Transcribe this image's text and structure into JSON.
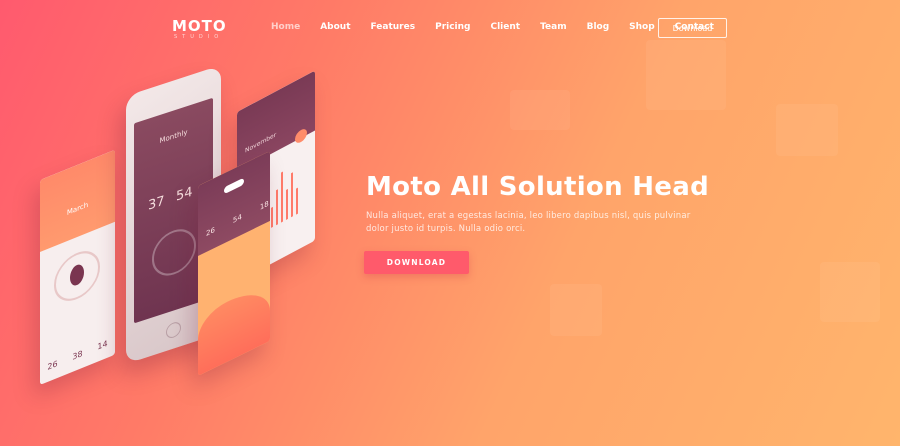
{
  "brand": {
    "logo": "MOTO",
    "tagline": "STUDIO"
  },
  "nav": {
    "items": [
      {
        "label": "Home",
        "active": true
      },
      {
        "label": "About"
      },
      {
        "label": "Features"
      },
      {
        "label": "Pricing"
      },
      {
        "label": "Client"
      },
      {
        "label": "Team"
      },
      {
        "label": "Blog"
      },
      {
        "label": "Shop"
      },
      {
        "label": "Contact"
      }
    ],
    "download_label": "Download"
  },
  "hero": {
    "title": "Moto All Solution Head",
    "subtitle": "Nulla aliquet, erat a egestas lacinia, leo libero dapibus nisl, quis pulvinar dolor justo id turpis. Nulla odio orci.",
    "button_label": "DOWNLOAD"
  },
  "devices": {
    "left_card": {
      "label": "March",
      "stats": [
        "26",
        "38",
        "14"
      ]
    },
    "phone": {
      "label": "Monthly",
      "value_a": "37",
      "value_b": "54"
    },
    "stats_card": {
      "label": "November"
    },
    "front_card": {
      "values": [
        "26",
        "54",
        "18"
      ]
    }
  },
  "colors": {
    "gradient_start": "#ff5a6e",
    "gradient_end": "#ffb56c",
    "accent_button": "#ff5a6b"
  }
}
